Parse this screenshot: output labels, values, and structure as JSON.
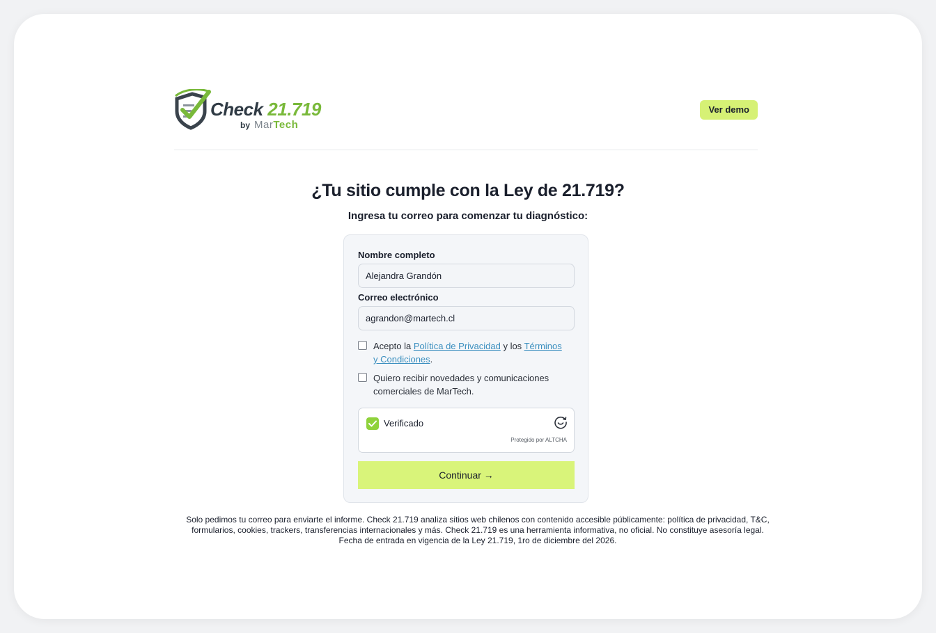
{
  "header": {
    "brand_check": "Check",
    "brand_number": "21.719",
    "brand_by": "by",
    "brand_mar": "Mar",
    "brand_tech": "Tech",
    "demo_label": "Ver demo"
  },
  "hero": {
    "title": "¿Tu sitio cumple con la Ley de 21.719?",
    "subtitle": "Ingresa tu correo para comenzar tu diagnóstico:"
  },
  "form": {
    "name_label": "Nombre completo",
    "name_value": "Alejandra Grandón",
    "email_label": "Correo electrónico",
    "email_value": "agrandon@martech.cl",
    "terms_prefix": "Acepto la ",
    "privacy_link": "Política de Privacidad",
    "terms_middle": " y los ",
    "terms_link": "Términos y Condiciones",
    "terms_suffix": ".",
    "terms_checked": false,
    "news_label": "Quiero recibir novedades y comunicaciones comerciales de MarTech.",
    "news_checked": false,
    "captcha_label": "Verificado",
    "captcha_protected": "Protegido por ALTCHA",
    "captcha_checked": true,
    "submit_label": "Continuar →"
  },
  "footer": {
    "disclaimer": "Solo pedimos tu correo para enviarte el informe. Check 21.719 analiza sitios web chilenos con contenido accesible públicamente: política de privacidad, T&C, formularios, cookies, trackers, transferencias internacionales y más. Check 21.719 es una herramienta informativa, no oficial. No constituye asesoría legal. Fecha de entrada en vigencia de la Ley 21.719, 1ro de diciembre del 2026."
  },
  "colors": {
    "accent": "#d9f47a",
    "brand_green": "#79b93a",
    "link": "#3b8fbf"
  },
  "icons": {
    "logo": "shield-check-icon",
    "captcha_check": "checkmark-icon",
    "captcha_logo": "altcha-logo-icon"
  }
}
